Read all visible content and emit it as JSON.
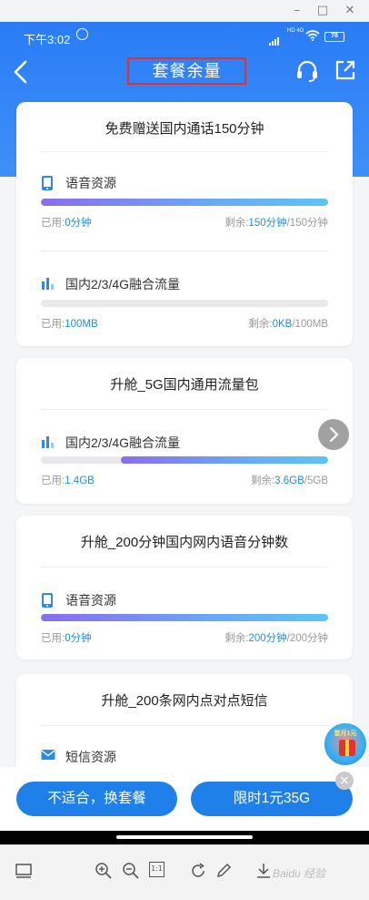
{
  "window": {
    "minimize": "–",
    "maximize": "□",
    "close": "✕"
  },
  "status_bar": {
    "time": "下午3:02",
    "network": "HD 4G",
    "battery": "78"
  },
  "header": {
    "title": "套餐余量"
  },
  "cards": [
    {
      "title": "免费赠送国内通话150分钟",
      "resources": [
        {
          "icon": "phone-icon",
          "name": "语音资源",
          "used_label": "已用:",
          "used_value": "0分钟",
          "remain_label": "剩余:",
          "remain_value": "150分钟",
          "total": "/150分钟",
          "remaining_fraction": 1.0
        },
        {
          "icon": "data-bars-icon",
          "name": "国内2/3/4G融合流量",
          "used_label": "已用:",
          "used_value": "100MB",
          "remain_label": "剩余:",
          "remain_value": "0KB",
          "total": "/100MB",
          "remaining_fraction": 0.0
        }
      ]
    },
    {
      "title": "升舱_5G国内通用流量包",
      "resources": [
        {
          "icon": "data-bars-icon",
          "name": "国内2/3/4G融合流量",
          "used_label": "已用:",
          "used_value": "1.4GB",
          "remain_label": "剩余:",
          "remain_value": "3.6GB",
          "total": "/5GB",
          "remaining_fraction": 0.72
        }
      ]
    },
    {
      "title": "升舱_200分钟国内网内语音分钟数",
      "resources": [
        {
          "icon": "phone-icon",
          "name": "语音资源",
          "used_label": "已用:",
          "used_value": "0分钟",
          "remain_label": "剩余:",
          "remain_value": "200分钟",
          "total": "/200分钟",
          "remaining_fraction": 1.0
        }
      ]
    },
    {
      "title": "升舱_200条网内点对点短信",
      "resources": [
        {
          "icon": "envelope-icon",
          "name": "短信资源"
        }
      ]
    }
  ],
  "promo_float": {
    "text": "首月1元"
  },
  "actions": {
    "change_plan": "不适合，换套餐",
    "promo": "限时1元35G"
  },
  "viewer": {
    "fit_label": "1:1",
    "watermark": "Baidu 经验"
  }
}
